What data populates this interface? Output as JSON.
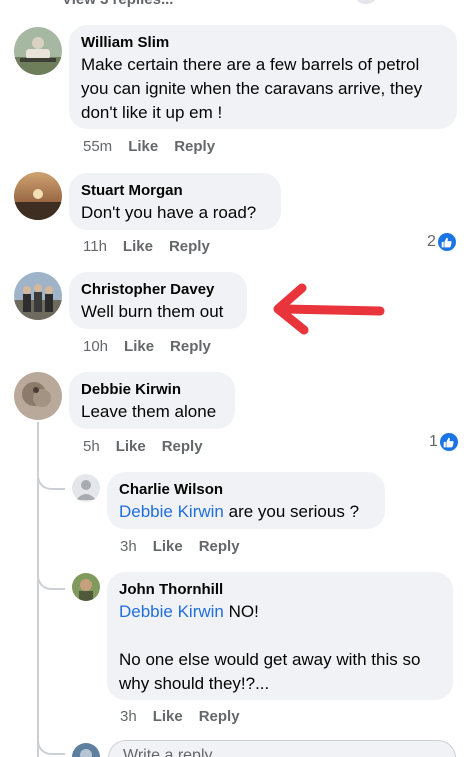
{
  "header": {
    "view_replies": "View 3 replies..."
  },
  "comments": [
    {
      "author": "William Slim",
      "text": "Make certain there are a few barrels of petrol you can ignite when the caravans arrive, they don't like it up em !",
      "time": "55m",
      "like": "Like",
      "reply": "Reply"
    },
    {
      "author": "Stuart Morgan",
      "text": "Don't you have a road?",
      "time": "11h",
      "like": "Like",
      "reply": "Reply",
      "reactions": "2"
    },
    {
      "author": "Christopher Davey",
      "text": "Well burn them out",
      "time": "10h",
      "like": "Like",
      "reply": "Reply"
    },
    {
      "author": "Debbie Kirwin",
      "text": "Leave them alone",
      "time": "5h",
      "like": "Like",
      "reply": "Reply",
      "reactions": "1"
    }
  ],
  "replies": [
    {
      "author": "Charlie Wilson",
      "tag": "Debbie Kirwin",
      "text": " are you serious ?",
      "time": "3h",
      "like": "Like",
      "reply": "Reply"
    },
    {
      "author": "John Thornhill",
      "tag": "Debbie Kirwin",
      "text": " NO!",
      "text2": "No one else would get away with this so why should they!?...",
      "time": "3h",
      "like": "Like",
      "reply": "Reply"
    }
  ],
  "reply_input": {
    "placeholder": "Write a reply..."
  },
  "colors": {
    "bubble": "#f0f2f5",
    "tag_blue": "#216fdb",
    "like_blue": "#1b74e4",
    "arrow_red": "#e8343a",
    "meta_gray": "#65676b"
  },
  "icons": [
    "like-reaction-icon",
    "arrow-annotation"
  ]
}
